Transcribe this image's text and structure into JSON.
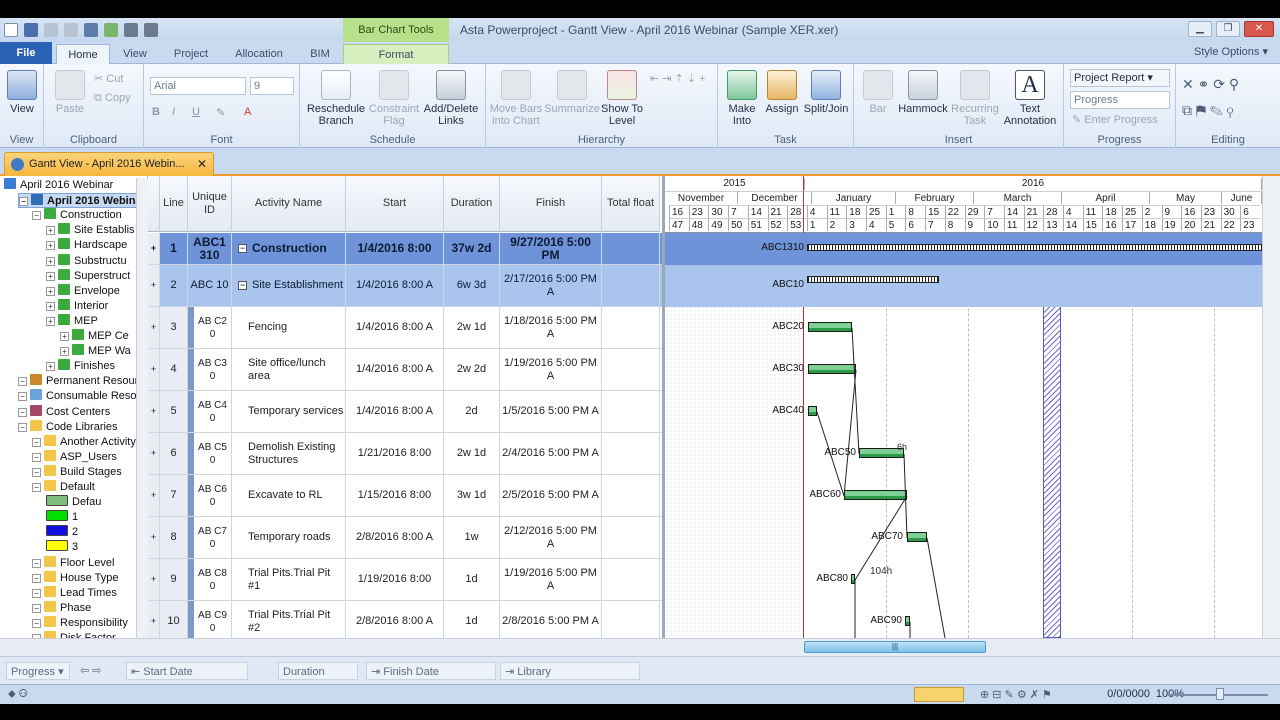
{
  "window": {
    "contextual_tab": "Bar Chart Tools",
    "title": "Asta Powerproject - Gantt View - April 2016 Webinar (Sample XER.xer)"
  },
  "tabs": [
    "File",
    "Home",
    "View",
    "Project",
    "Allocation",
    "BIM",
    "Format"
  ],
  "style_options": "Style Options",
  "ribbon": {
    "view_label": "View",
    "paste": "Paste",
    "cut": "Cut",
    "copy": "Copy",
    "font_name": "Arial",
    "font_size": "9",
    "reschedule": "Reschedule Branch",
    "constraint_flag": "Constraint Flag",
    "add_delete_links": "Add/Delete Links",
    "move_bars": "Move Bars into Chart",
    "summarize": "Summarize",
    "show_to_level": "Show To Level",
    "make_into": "Make Into",
    "assign": "Assign",
    "split_join": "Split/Join",
    "bar": "Bar",
    "hammock": "Hammock",
    "recurring_task": "Recurring Task",
    "text_annotation": "Text Annotation",
    "project_report": "Project Report",
    "progress_field": "Progress",
    "enter_progress": "Enter Progress",
    "groups": {
      "view": "View",
      "clipboard": "Clipboard",
      "font": "Font",
      "schedule": "Schedule",
      "hierarchy": "Hierarchy",
      "task": "Task",
      "insert": "Insert",
      "progress": "Progress",
      "editing": "Editing"
    }
  },
  "doc_tab": "Gantt View - April 2016 Webin...",
  "tree": [
    {
      "label": "April 2016 Webinar",
      "depth": 0,
      "icon": "globe-icon"
    },
    {
      "label": "April 2016 Webina",
      "depth": 1,
      "icon": "project-icon",
      "selected": true
    },
    {
      "label": "Construction",
      "depth": 2,
      "icon": "wbs-icon"
    },
    {
      "label": "Site Establis",
      "depth": 3,
      "icon": "wbs-icon"
    },
    {
      "label": "Hardscape",
      "depth": 3,
      "icon": "wbs-icon"
    },
    {
      "label": "Substructu",
      "depth": 3,
      "icon": "wbs-icon"
    },
    {
      "label": "Superstruct",
      "depth": 3,
      "icon": "wbs-icon"
    },
    {
      "label": "Envelope",
      "depth": 3,
      "icon": "wbs-icon"
    },
    {
      "label": "Interior",
      "depth": 3,
      "icon": "wbs-icon"
    },
    {
      "label": "MEP",
      "depth": 3,
      "icon": "wbs-icon"
    },
    {
      "label": "MEP Ce",
      "depth": 4,
      "icon": "wbs-icon"
    },
    {
      "label": "MEP Wa",
      "depth": 4,
      "icon": "wbs-icon"
    },
    {
      "label": "Finishes",
      "depth": 3,
      "icon": "wbs-icon"
    },
    {
      "label": "Permanent Resourc",
      "depth": 1,
      "icon": "person-icon"
    },
    {
      "label": "Consumable Resou",
      "depth": 1,
      "icon": "consumable-icon"
    },
    {
      "label": "Cost Centers",
      "depth": 1,
      "icon": "cost-icon"
    },
    {
      "label": "Code Libraries",
      "depth": 1,
      "icon": "folder-icon"
    },
    {
      "label": "Another Activity",
      "depth": 2,
      "icon": "folder-icon"
    },
    {
      "label": "ASP_Users",
      "depth": 2,
      "icon": "folder-icon"
    },
    {
      "label": "Build Stages",
      "depth": 2,
      "icon": "folder-icon"
    },
    {
      "label": "Default",
      "depth": 2,
      "icon": "folder-open-icon"
    },
    {
      "label": "Defau",
      "depth": 3,
      "icon": "swatch-icon",
      "color": "#7dbf7d"
    },
    {
      "label": "1",
      "depth": 3,
      "icon": "swatch-icon",
      "color": "#00e000"
    },
    {
      "label": "2",
      "depth": 3,
      "icon": "swatch-icon",
      "color": "#1010e0"
    },
    {
      "label": "3",
      "depth": 3,
      "icon": "swatch-icon",
      "color": "#ffff00"
    },
    {
      "label": "Floor Level",
      "depth": 2,
      "icon": "folder-icon"
    },
    {
      "label": "House Type",
      "depth": 2,
      "icon": "folder-icon"
    },
    {
      "label": "Lead Times",
      "depth": 2,
      "icon": "folder-icon"
    },
    {
      "label": "Phase",
      "depth": 2,
      "icon": "folder-icon"
    },
    {
      "label": "Responsibility",
      "depth": 2,
      "icon": "folder-icon"
    },
    {
      "label": "Disk Factor",
      "depth": 2,
      "icon": "folder-icon"
    }
  ],
  "columns": [
    "Line",
    "Unique ID",
    "Activity Name",
    "Start",
    "Duration",
    "Finish",
    "Total float"
  ],
  "rows": [
    {
      "line": "1",
      "uid": "ABC1 310",
      "name": "Construction",
      "start": "1/4/2016 8:00",
      "duration": "37w 2d",
      "finish": "9/27/2016 5:00 PM",
      "float": "",
      "type": "sum1"
    },
    {
      "line": "2",
      "uid": "ABC 10",
      "name": "Site Establishment",
      "start": "1/4/2016 8:00 A",
      "duration": "6w 3d",
      "finish": "2/17/2016 5:00 PM A",
      "float": "",
      "type": "sum2"
    },
    {
      "line": "3",
      "uid": "AB C2 0",
      "name": "Fencing",
      "start": "1/4/2016 8:00 A",
      "duration": "2w 1d",
      "finish": "1/18/2016 5:00 PM A",
      "float": "",
      "type": "task"
    },
    {
      "line": "4",
      "uid": "AB C3 0",
      "name": "Site office/lunch area",
      "start": "1/4/2016 8:00 A",
      "duration": "2w 2d",
      "finish": "1/19/2016 5:00 PM A",
      "float": "",
      "type": "task"
    },
    {
      "line": "5",
      "uid": "AB C4 0",
      "name": "Temporary services",
      "start": "1/4/2016 8:00 A",
      "duration": "2d",
      "finish": "1/5/2016 5:00 PM A",
      "float": "",
      "type": "task"
    },
    {
      "line": "6",
      "uid": "AB C5 0",
      "name": "Demolish Existing Structures",
      "start": "1/21/2016 8:00",
      "duration": "2w 1d",
      "finish": "2/4/2016 5:00 PM A",
      "float": "",
      "type": "task"
    },
    {
      "line": "7",
      "uid": "AB C6 0",
      "name": "Excavate to RL",
      "start": "1/15/2016 8:00",
      "duration": "3w 1d",
      "finish": "2/5/2016 5:00 PM A",
      "float": "",
      "type": "task"
    },
    {
      "line": "8",
      "uid": "AB C7 0",
      "name": "Temporary roads",
      "start": "2/8/2016 8:00 A",
      "duration": "1w",
      "finish": "2/12/2016 5:00 PM A",
      "float": "",
      "type": "task"
    },
    {
      "line": "9",
      "uid": "AB C8 0",
      "name": "Trial Pits.Trial Pit #1",
      "start": "1/19/2016 8:00",
      "duration": "1d",
      "finish": "1/19/2016 5:00 PM A",
      "float": "",
      "type": "task"
    },
    {
      "line": "10",
      "uid": "AB C9 0",
      "name": "Trial Pits.Trial Pit #2",
      "start": "2/8/2016 8:00 A",
      "duration": "1d",
      "finish": "2/8/2016 5:00 PM A",
      "float": "",
      "type": "task"
    },
    {
      "line": "",
      "uid": "AB",
      "name": "Trial",
      "start": "",
      "duration": "",
      "finish": "",
      "float": "",
      "type": "task"
    }
  ],
  "timescale": {
    "years": [
      "2015",
      "2016"
    ],
    "months": [
      "November",
      "December",
      "January",
      "February",
      "March",
      "April",
      "May",
      "June"
    ],
    "days": [
      "16",
      "23",
      "30",
      "7",
      "14",
      "21",
      "28",
      "4",
      "11",
      "18",
      "25",
      "1",
      "8",
      "15",
      "22",
      "29",
      "7",
      "14",
      "21",
      "28",
      "4",
      "11",
      "18",
      "25",
      "2",
      "9",
      "16",
      "23",
      "30",
      "6"
    ],
    "weeks": [
      "47",
      "48",
      "49",
      "50",
      "51",
      "52",
      "53",
      "1",
      "2",
      "3",
      "4",
      "5",
      "6",
      "7",
      "8",
      "9",
      "10",
      "11",
      "12",
      "13",
      "14",
      "15",
      "16",
      "17",
      "18",
      "19",
      "20",
      "21",
      "22",
      "23"
    ]
  },
  "bar_labels": [
    "ABC1310",
    "ABC10",
    "ABC20",
    "ABC30",
    "ABC40",
    "ABC50",
    "ABC60",
    "ABC70",
    "ABC80",
    "ABC90"
  ],
  "bar_notes": {
    "abc50": "6h",
    "abc80": "104h"
  },
  "bottom_toolbar": {
    "progress": "Progress",
    "start_date": "Start Date",
    "duration": "Duration",
    "finish_date": "Finish Date",
    "library": "Library"
  },
  "status": {
    "count": "0/0/0000",
    "zoom": "100%"
  }
}
